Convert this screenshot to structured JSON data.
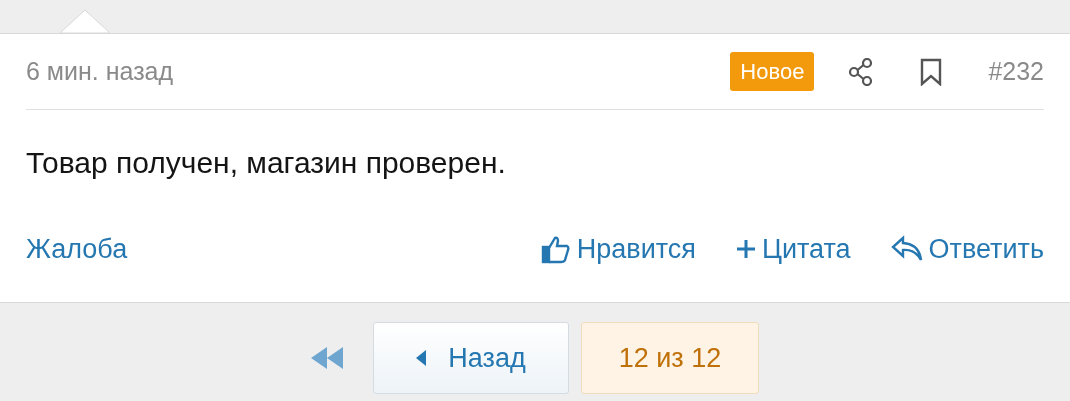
{
  "post": {
    "time": "6 мин. назад",
    "badge": "Новое",
    "number": "#232",
    "message": "Товар получен, магазин проверен.",
    "actions": [
      {
        "kind": "report",
        "label": "Жалоба"
      },
      {
        "kind": "like",
        "label": "Нравится"
      },
      {
        "kind": "quote",
        "label": "Цитата"
      },
      {
        "kind": "reply",
        "label": "Ответить"
      }
    ]
  },
  "pagination": {
    "previous": "Назад",
    "current": "12 из 12"
  }
}
